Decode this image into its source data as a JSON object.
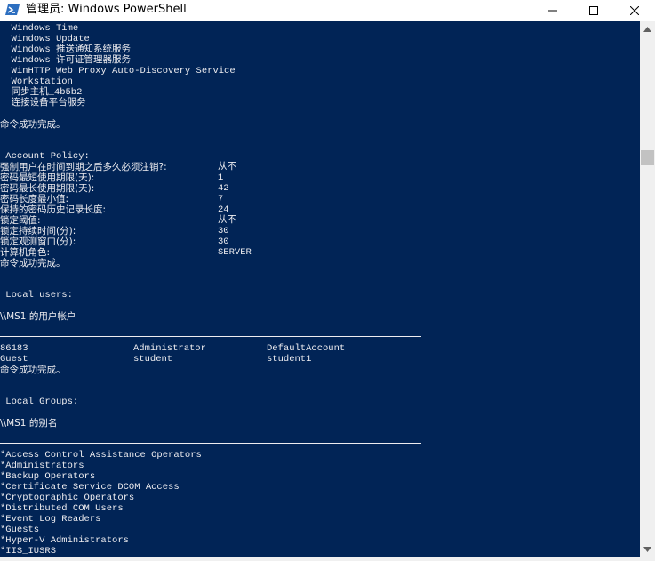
{
  "window": {
    "title": "管理员: Windows PowerShell",
    "icon": "powershell-icon",
    "controls": [
      "minimize-icon",
      "maximize-icon",
      "close-icon"
    ]
  },
  "colors": {
    "console_bg": "#012456",
    "console_fg": "#eeedf0"
  },
  "console": {
    "services": [
      "  Windows Time",
      "  Windows Update",
      "  Windows 推送通知系统服务",
      "  Windows 许可证管理器服务",
      "  WinHTTP Web Proxy Auto-Discovery Service",
      "  Workstation",
      "  同步主机_4b5b2",
      "  连接设备平台服务"
    ],
    "done1": "命令成功完成。",
    "account_policy_header": " Account Policy:",
    "policy": [
      {
        "label": "强制用户在时间到期之后多久必须注销?:",
        "value": "从不"
      },
      {
        "label": "密码最短使用期限(天):",
        "value": "1"
      },
      {
        "label": "密码最长使用期限(天):",
        "value": "42"
      },
      {
        "label": "密码长度最小值:",
        "value": "7"
      },
      {
        "label": "保持的密码历史记录长度:",
        "value": "24"
      },
      {
        "label": "锁定阈值:",
        "value": "从不"
      },
      {
        "label": "锁定持续时间(分):",
        "value": "30"
      },
      {
        "label": "锁定观测窗口(分):",
        "value": "30"
      },
      {
        "label": "计算机角色:",
        "value": "SERVER"
      }
    ],
    "done2": "命令成功完成。",
    "local_users_header": " Local users:",
    "users_title": "\\\\MS1 的用户帐户",
    "users": [
      [
        "86183",
        "Administrator",
        "DefaultAccount"
      ],
      [
        "Guest",
        "student",
        "student1"
      ]
    ],
    "done3": "命令成功完成。",
    "local_groups_header": " Local Groups:",
    "groups_title": "\\\\MS1 的别名",
    "groups": [
      "*Access Control Assistance Operators",
      "*Administrators",
      "*Backup Operators",
      "*Certificate Service DCOM Access",
      "*Cryptographic Operators",
      "*Distributed COM Users",
      "*Event Log Readers",
      "*Guests",
      "*Hyper-V Administrators",
      "*IIS_IUSRS"
    ]
  }
}
